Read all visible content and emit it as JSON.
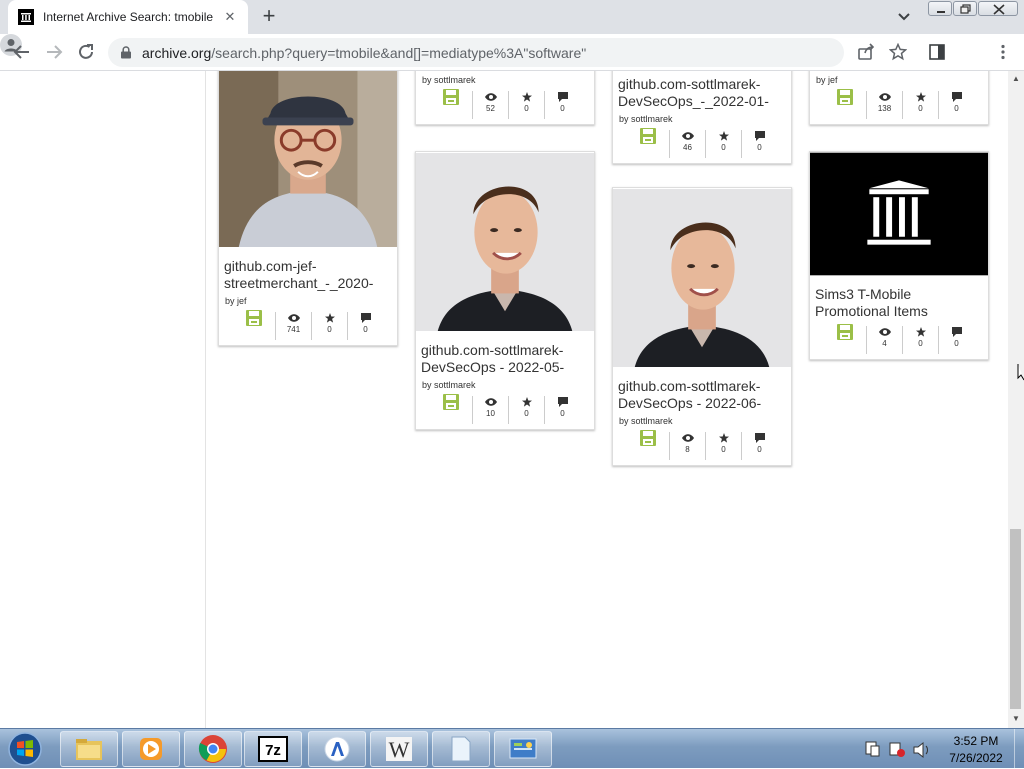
{
  "browser": {
    "tab_title": "Internet Archive Search: tmobile",
    "tab_close": "✕",
    "new_tab": "+",
    "url_host": "archive.org",
    "url_rest": "/search.php?query=tmobile&and[]=mediatype%3A\"software\""
  },
  "items": [
    {
      "title": "github.com-jef-streetmerchant_-_2020-",
      "by": "by jef",
      "views": "741",
      "favs": "0",
      "reviews": "0",
      "image": "photo-man-glasses"
    },
    {
      "title": "",
      "by": "by sottlmarek",
      "views": "52",
      "favs": "0",
      "reviews": "0",
      "image": ""
    },
    {
      "title": "github.com-sottlmarek-DevSecOps - 2022-05-",
      "by": "by sottlmarek",
      "views": "10",
      "favs": "0",
      "reviews": "0",
      "image": "photo-man-portrait"
    },
    {
      "title": "github.com-sottlmarek-DevSecOps_-_2022-01-",
      "by": "by sottlmarek",
      "views": "46",
      "favs": "0",
      "reviews": "0",
      "image": ""
    },
    {
      "title": "github.com-sottlmarek-DevSecOps - 2022-06-",
      "by": "by sottlmarek",
      "views": "8",
      "favs": "0",
      "reviews": "0",
      "image": "photo-man-portrait"
    },
    {
      "title": "",
      "by": "by jef",
      "views": "138",
      "favs": "0",
      "reviews": "0",
      "image": ""
    },
    {
      "title": "Sims3 T-Mobile Promotional Items",
      "by": "",
      "views": "4",
      "favs": "0",
      "reviews": "0",
      "image": "archive-logo"
    }
  ],
  "taskbar": {
    "apps": [
      "explorer",
      "media-player",
      "chrome",
      "7zip",
      "app-blue",
      "wordpad",
      "notepad",
      "control-panel"
    ],
    "time": "3:52 PM",
    "date": "7/26/2022"
  },
  "colors": {
    "software_icon": "#9bbf48",
    "tab_strip": "#dee1e6",
    "taskbar": "#7d9cbf"
  }
}
